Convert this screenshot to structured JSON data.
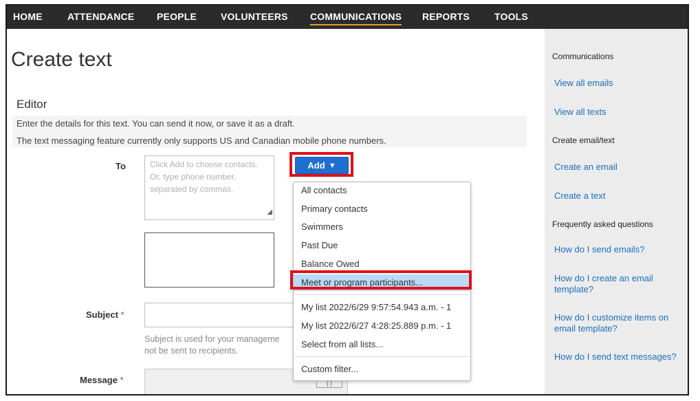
{
  "nav": {
    "items": [
      "HOME",
      "ATTENDANCE",
      "PEOPLE",
      "VOLUNTEERS",
      "COMMUNICATIONS",
      "REPORTS",
      "TOOLS"
    ],
    "active": "COMMUNICATIONS",
    "active_color": "#e8a020"
  },
  "page": {
    "title": "Create text"
  },
  "editor": {
    "title": "Editor",
    "info_1": "Enter the details for this text. You can send it now, or save it as a draft.",
    "info_2": "The text messaging feature currently only supports US and Canadian mobile phone numbers."
  },
  "form": {
    "to_label": "To",
    "to_placeholder": "Click Add to choose contacts. Or, type phone number, separated by commas.",
    "subject_label": "Subject",
    "subject_required": "*",
    "subject_help_1": "Subject is used for your manageme",
    "subject_help_2": "not be sent to recipients.",
    "message_label": "Message",
    "message_required": "*",
    "token_glyph": "{ }"
  },
  "add_button": {
    "label": "Add",
    "caret": "▼",
    "color": "#1f6fd0"
  },
  "dropdown": {
    "group_1": [
      "All contacts",
      "Primary contacts",
      "Swimmers",
      "Past Due",
      "Balance Owed",
      "Meet or program participants..."
    ],
    "group_2": [
      "My list 2022/6/29 9:57:54.943 a.m. - 1",
      "My list 2022/6/27 4:28:25.889 p.m. - 1",
      "Select from all lists..."
    ],
    "group_3": [
      "Custom filter..."
    ],
    "highlighted": "Meet or program participants...",
    "highlight_color": "#e01018"
  },
  "sidebar": {
    "heading_1": "Communications",
    "links_1": [
      "View all emails",
      "View all texts"
    ],
    "heading_2": "Create email/text",
    "links_2": [
      "Create an email",
      "Create a text"
    ],
    "heading_3": "Frequently asked questions",
    "links_3": [
      "How do I send emails?",
      "How do I create an email template?",
      "How do I customize items on email template?",
      "How do I send text messages?"
    ],
    "link_color": "#1a6fc2"
  }
}
